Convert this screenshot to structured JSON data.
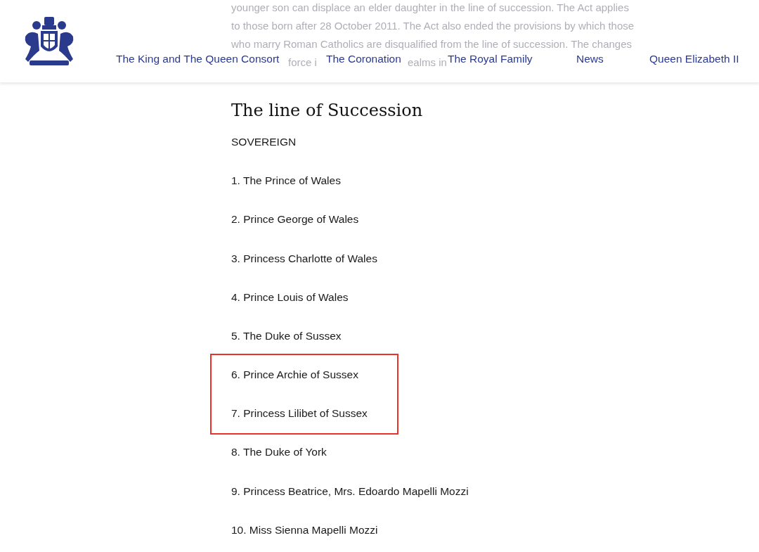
{
  "background_text": {
    "lines": [
      "younger son can displace an elder daughter in the line of succession. The Act applies",
      "to those born after 28 October 2011. The Act also ended the provisions by which those",
      "who marry Roman Catholics are disqualified from the line of succession. The changes"
    ],
    "partial_line": [
      "force i",
      "ealms in"
    ]
  },
  "nav": [
    {
      "label": "The King and The Queen Consort"
    },
    {
      "label": "The Coronation"
    },
    {
      "label": "The Royal Family"
    },
    {
      "label": "News"
    },
    {
      "label": "Queen Elizabeth II"
    }
  ],
  "heading": "The line of Succession",
  "sovereign": "SOVEREIGN",
  "succession": [
    {
      "text": "1. The Prince of Wales",
      "highlighted": false
    },
    {
      "text": "2. Prince George of Wales",
      "highlighted": false
    },
    {
      "text": "3. Princess Charlotte of Wales",
      "highlighted": false
    },
    {
      "text": "4. Prince Louis of Wales",
      "highlighted": false
    },
    {
      "text": "5. The Duke of Sussex",
      "highlighted": false
    },
    {
      "text": "6. Prince Archie of Sussex",
      "highlighted": true
    },
    {
      "text": "7. Princess Lilibet of Sussex",
      "highlighted": true
    },
    {
      "text": "8. The Duke of York",
      "highlighted": false
    },
    {
      "text": "9. Princess Beatrice, Mrs. Edoardo Mapelli Mozzi",
      "highlighted": false
    },
    {
      "text": "10. Miss Sienna Mapelli Mozzi",
      "highlighted": false
    }
  ]
}
